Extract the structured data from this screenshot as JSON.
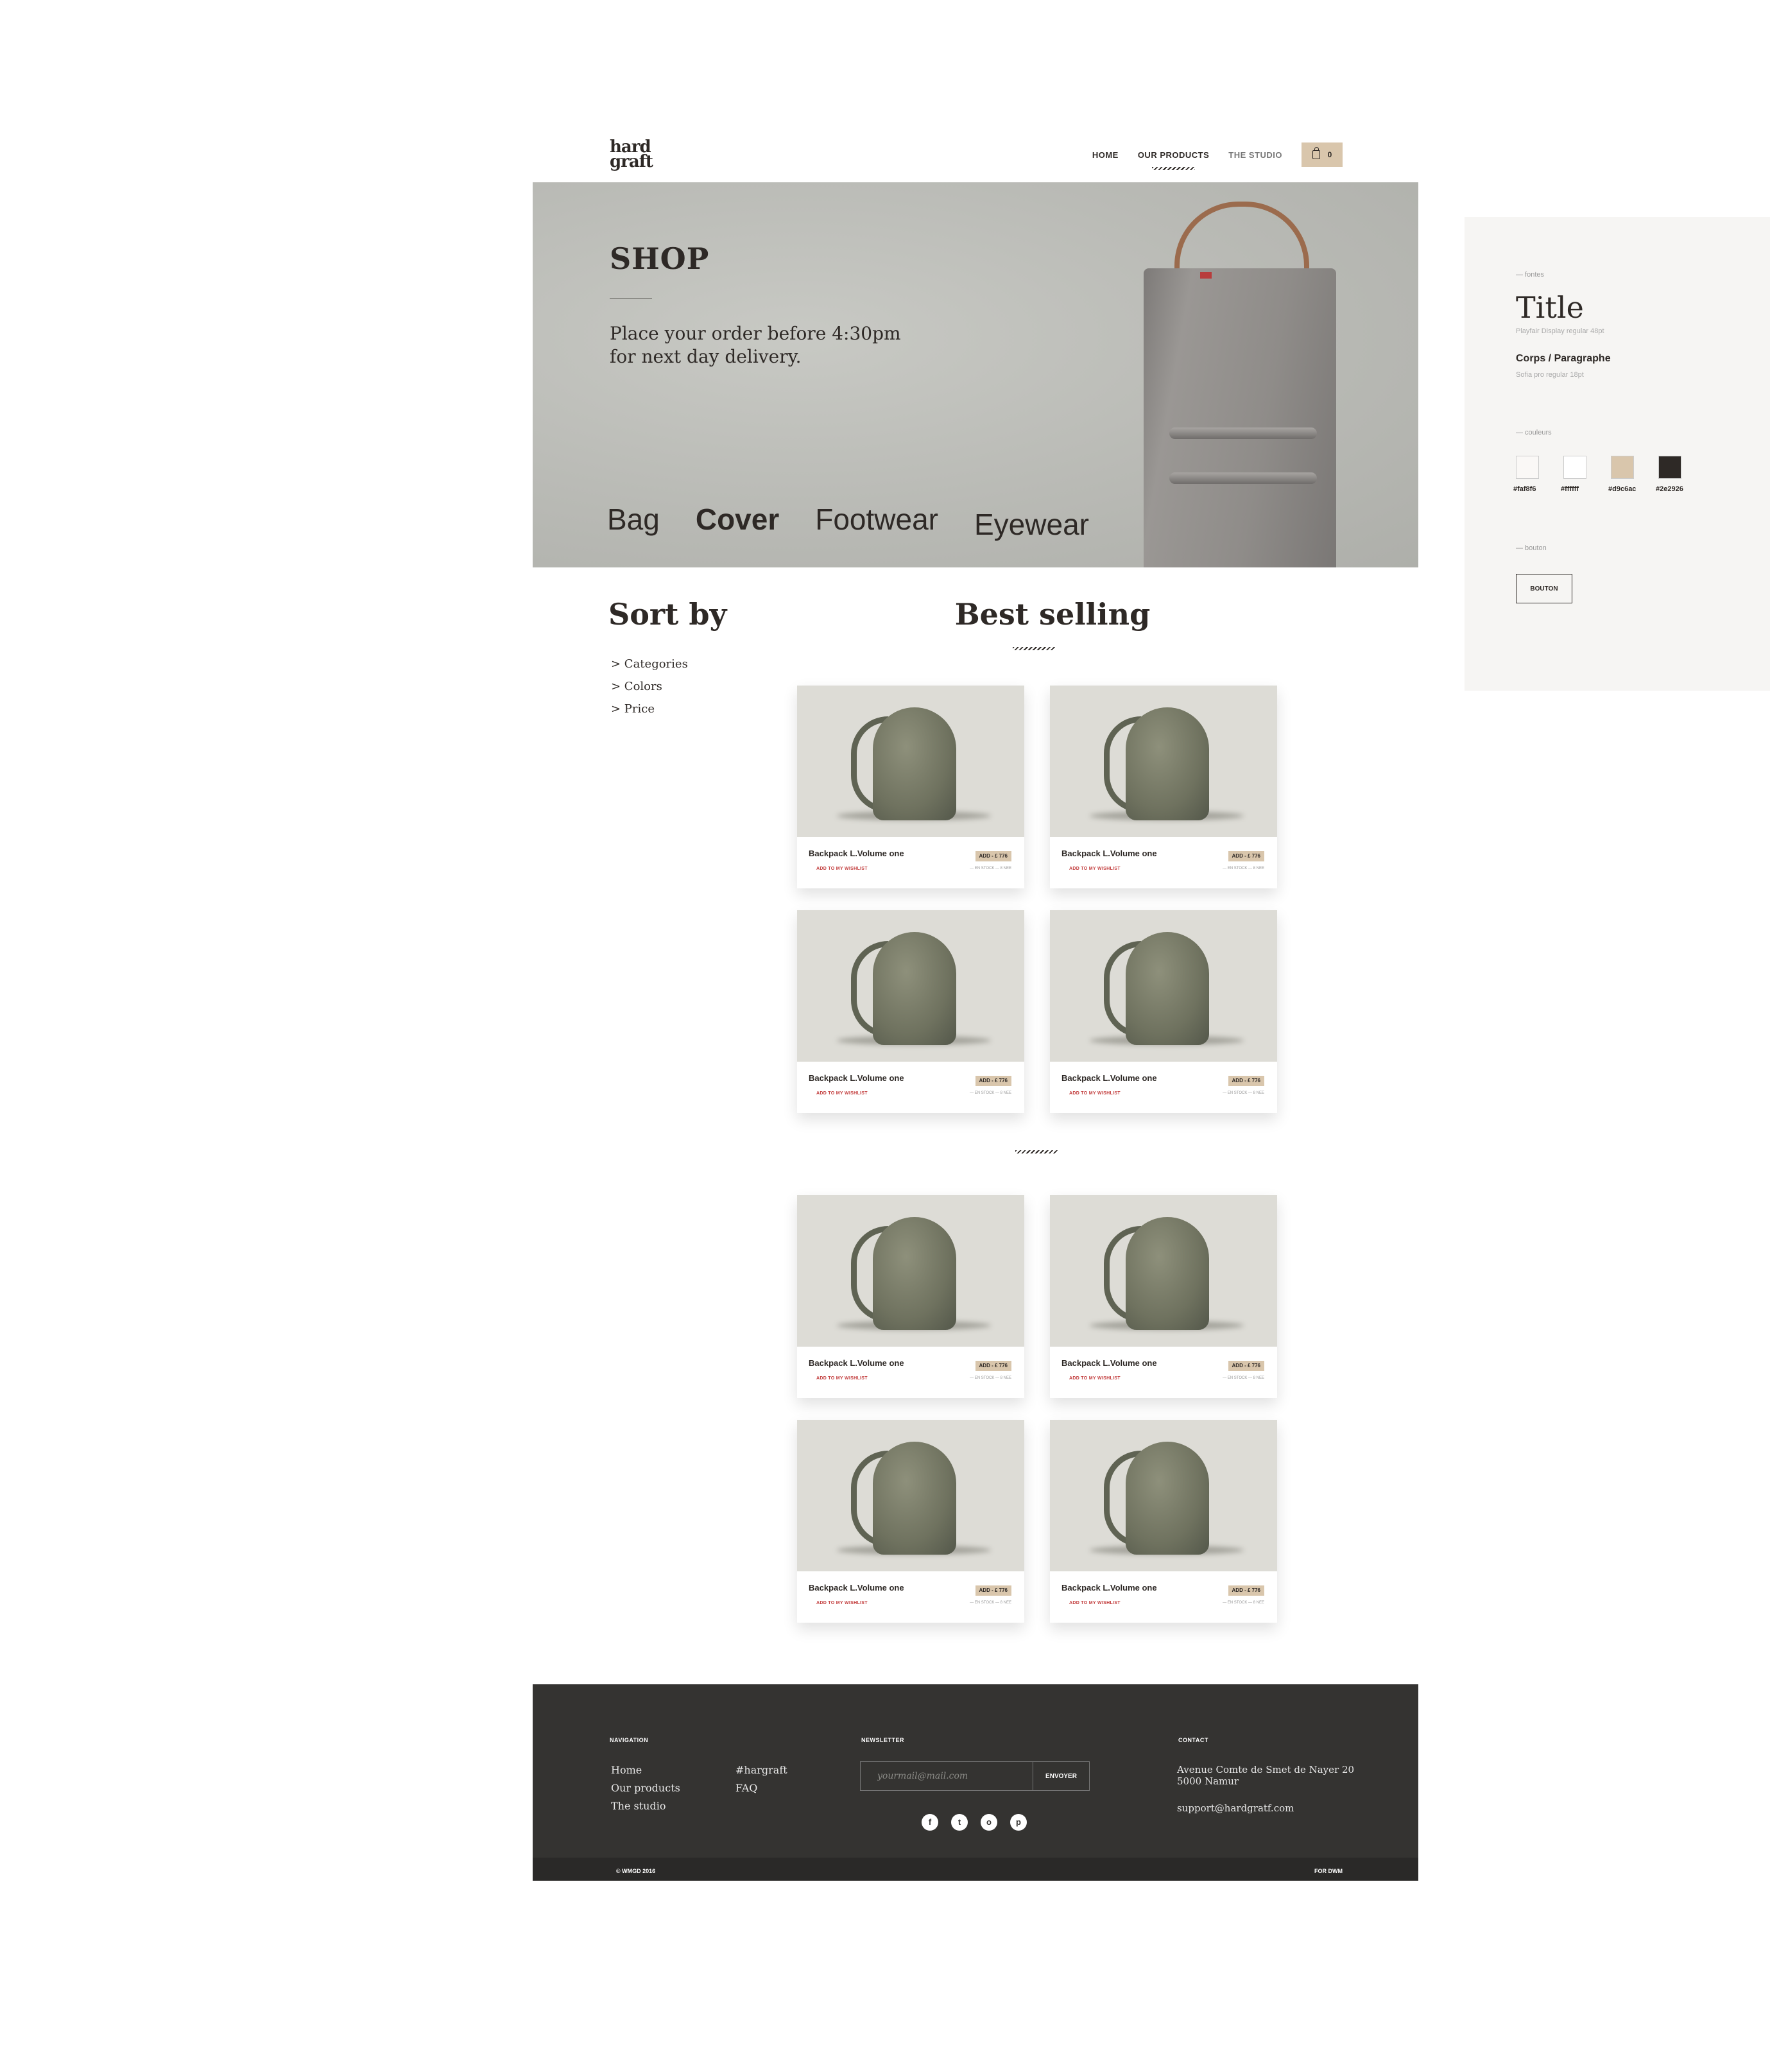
{
  "header": {
    "logo_line1": "hard",
    "logo_line2": "graft",
    "nav": [
      {
        "label": "HOME"
      },
      {
        "label": "OUR PRODUCTS"
      },
      {
        "label": "THE STUDIO"
      }
    ],
    "cart_count": "0"
  },
  "hero": {
    "title": "SHOP",
    "text": "Place your order before 4:30pm for next day delivery.",
    "categories": [
      "Bag",
      "Cover",
      "Footwear",
      "Eyewear"
    ],
    "active_category": "Cover"
  },
  "sort": {
    "title": "Sort by",
    "items": [
      "> Categories",
      "> Colors",
      "> Price"
    ]
  },
  "products": {
    "title": "Best selling",
    "items": [
      {
        "name": "Backpack L.Volume one",
        "add": "ADD - £ 776",
        "wishlist": "ADD TO MY WISHLIST",
        "stock": "— EN STOCK — 8 NEE"
      },
      {
        "name": "Backpack L.Volume one",
        "add": "ADD - £ 776",
        "wishlist": "ADD TO MY WISHLIST",
        "stock": "— EN STOCK — 8 NEE"
      },
      {
        "name": "Backpack L.Volume one",
        "add": "ADD - £ 776",
        "wishlist": "ADD TO MY WISHLIST",
        "stock": "— EN STOCK — 8 NEE"
      },
      {
        "name": "Backpack L.Volume one",
        "add": "ADD - £ 776",
        "wishlist": "ADD TO MY WISHLIST",
        "stock": "— EN STOCK — 8 NEE"
      },
      {
        "name": "Backpack L.Volume one",
        "add": "ADD - £ 776",
        "wishlist": "ADD TO MY WISHLIST",
        "stock": "— EN STOCK — 8 NEE"
      },
      {
        "name": "Backpack L.Volume one",
        "add": "ADD - £ 776",
        "wishlist": "ADD TO MY WISHLIST",
        "stock": "— EN STOCK — 8 NEE"
      },
      {
        "name": "Backpack L.Volume one",
        "add": "ADD - £ 776",
        "wishlist": "ADD TO MY WISHLIST",
        "stock": "— EN STOCK — 8 NEE"
      },
      {
        "name": "Backpack L.Volume one",
        "add": "ADD - £ 776",
        "wishlist": "ADD TO MY WISHLIST",
        "stock": "— EN STOCK — 8 NEE"
      }
    ]
  },
  "footer": {
    "nav_heading": "NAVIGATION",
    "nav_links": [
      "Home",
      "Our products",
      "The studio"
    ],
    "extra_links": [
      "#hargraft",
      "FAQ"
    ],
    "newsletter_heading": "NEWSLETTER",
    "newsletter_placeholder": "yourmail@mail.com",
    "newsletter_button": "ENVOYER",
    "social": [
      "f",
      "t",
      "o",
      "p"
    ],
    "contact_heading": "CONTACT",
    "address_line1": "Avenue Comte de Smet de Nayer 20",
    "address_line2": "5000 Namur",
    "email": "support@hardgratf.com",
    "copyright": "© WMGD 2016",
    "credit": "FOR DWM"
  },
  "styleguide": {
    "fonts_label": "— fontes",
    "title_sample": "Title",
    "title_spec": "Playfair Display regular 48pt",
    "body_sample": "Corps / Paragraphe",
    "body_spec": "Sofia pro regular 18pt",
    "colors_label": "— couleurs",
    "colors": [
      {
        "hex": "#faf8f6",
        "label": "#faf8f6"
      },
      {
        "hex": "#ffffff",
        "label": "#ffffff"
      },
      {
        "hex": "#d9c6ac",
        "label": "#d9c6ac"
      },
      {
        "hex": "#2e2926",
        "label": "#2e2926"
      }
    ],
    "button_label": "— bouton",
    "button_sample": "BOUTON"
  }
}
